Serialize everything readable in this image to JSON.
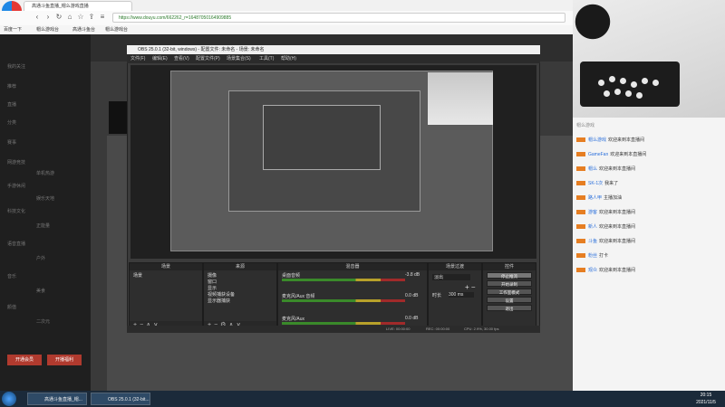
{
  "browser": {
    "tab_title": "高通斗鱼直播_帽么游戏直播",
    "url": "https://www.douyu.com/662262_r=16487050164909885",
    "bookmarks": [
      "百度一下",
      "帽么游戏台",
      "高通斗鱼台",
      "帽么游戏台"
    ]
  },
  "page": {
    "sidebar_items": [
      "我的关注",
      "推荐",
      "直播",
      "分类",
      "赛事",
      "网游竞技",
      "单机热游",
      "手游休闲",
      "娱乐天地",
      "科技文化",
      "正能量",
      "语音直播",
      "户外",
      "音乐",
      "美食",
      "颜值",
      "二次元"
    ],
    "promo_buttons": [
      "开通会员",
      "开播福利"
    ]
  },
  "obs": {
    "title": "OBS 25.0.1 (32-bit, windows) - 配置文件: 未命名 - 场景: 未命名",
    "menu": [
      "文件(F)",
      "编辑(E)",
      "查看(V)",
      "配置文件(P)",
      "场景集合(S)",
      "工具(T)",
      "帮助(H)"
    ],
    "docks": {
      "scenes": {
        "title": "场景",
        "items": [
          "场景"
        ]
      },
      "sources": {
        "title": "来源",
        "items": [
          "摄像",
          "窗口",
          "显示",
          "视频捕获设备",
          "显示器捕获"
        ]
      },
      "mixer": {
        "title": "混音器",
        "tracks": [
          {
            "name": "桌面音频",
            "level": "-3.8 dB"
          },
          {
            "name": "麦克风/Aux 音频",
            "level": "0.0 dB"
          },
          {
            "name": "麦克风/Aux",
            "level": "0.0 dB"
          }
        ]
      },
      "transitions": {
        "title": "场景过渡",
        "type": "淡出",
        "duration_label": "时长",
        "duration_value": "300 ms"
      },
      "controls": {
        "title": "控件",
        "buttons": [
          "停止推流",
          "开始录制",
          "工作室模式",
          "设置",
          "退出"
        ]
      }
    },
    "status": {
      "live": "LIVE: 00:00:00",
      "rec": "REC: 00:00:00",
      "cpu": "CPU: 2.9%, 30.00 fps"
    }
  },
  "chat": {
    "rank_label": "帽么游戏",
    "rows": [
      {
        "user": "帽么游戏",
        "msg": "欢迎来到本直播间"
      },
      {
        "user": "GameFan",
        "msg": "欢迎来到本直播间"
      },
      {
        "user": "帽么",
        "msg": "欢迎来到本直播间"
      },
      {
        "user": "SK-1次",
        "msg": "我来了"
      },
      {
        "user": "路人甲",
        "msg": "主播加油"
      },
      {
        "user": "游客",
        "msg": "欢迎来到本直播间"
      },
      {
        "user": "新人",
        "msg": "欢迎来到本直播间"
      },
      {
        "user": "斗鱼",
        "msg": "欢迎来到本直播间"
      },
      {
        "user": "粉丝",
        "msg": "打卡"
      },
      {
        "user": "观众",
        "msg": "欢迎来到本直播间"
      }
    ]
  },
  "taskbar": {
    "tasks": [
      "高通斗鱼直播_帽...",
      "OBS 25.0.1 (32-bit..."
    ],
    "time": "20:15",
    "date": "2021/11/5"
  }
}
